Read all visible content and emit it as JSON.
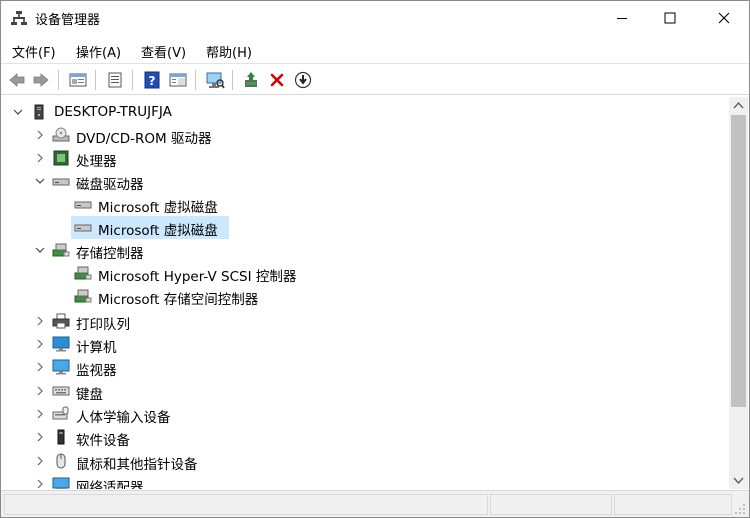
{
  "window": {
    "title": "设备管理器"
  },
  "menubar": {
    "items": [
      "文件(F)",
      "操作(A)",
      "查看(V)",
      "帮助(H)"
    ]
  },
  "toolbar": {
    "buttons": [
      "back-icon",
      "forward-icon",
      "view-icon",
      "properties-icon",
      "help-icon",
      "action-view-icon",
      "scan-hardware-icon",
      "update-driver-icon",
      "uninstall-icon",
      "disable-icon"
    ]
  },
  "tree": {
    "root": "DESKTOP-TRUJFJA",
    "nodes": [
      {
        "label": "DVD/CD-ROM 驱动器",
        "icon": "dvd-drive-icon",
        "expanded": false
      },
      {
        "label": "处理器",
        "icon": "processor-icon",
        "expanded": false
      },
      {
        "label": "磁盘驱动器",
        "icon": "disk-drive-icon",
        "expanded": true
      },
      {
        "label": "Microsoft 虚拟磁盘",
        "icon": "disk-drive-icon",
        "child": true
      },
      {
        "label": "Microsoft 虚拟磁盘",
        "icon": "disk-drive-icon",
        "child": true,
        "selected": true
      },
      {
        "label": "存储控制器",
        "icon": "storage-controller-icon",
        "expanded": true
      },
      {
        "label": "Microsoft Hyper-V SCSI 控制器",
        "icon": "storage-controller-icon",
        "child": true
      },
      {
        "label": "Microsoft 存储空间控制器",
        "icon": "storage-controller-icon",
        "child": true
      },
      {
        "label": "打印队列",
        "icon": "printer-icon",
        "expanded": false
      },
      {
        "label": "计算机",
        "icon": "computer-icon",
        "expanded": false
      },
      {
        "label": "监视器",
        "icon": "monitor-icon",
        "expanded": false
      },
      {
        "label": "键盘",
        "icon": "keyboard-icon",
        "expanded": false
      },
      {
        "label": "人体学输入设备",
        "icon": "hid-icon",
        "expanded": false
      },
      {
        "label": "软件设备",
        "icon": "software-device-icon",
        "expanded": false
      },
      {
        "label": "鼠标和其他指针设备",
        "icon": "mouse-icon",
        "expanded": false
      },
      {
        "label": "网络适配器",
        "icon": "network-adapter-icon",
        "expanded": false
      }
    ]
  },
  "colors": {
    "selection": "#cce8ff",
    "uninstall": "#d40000",
    "help": "#1f4fb5"
  }
}
